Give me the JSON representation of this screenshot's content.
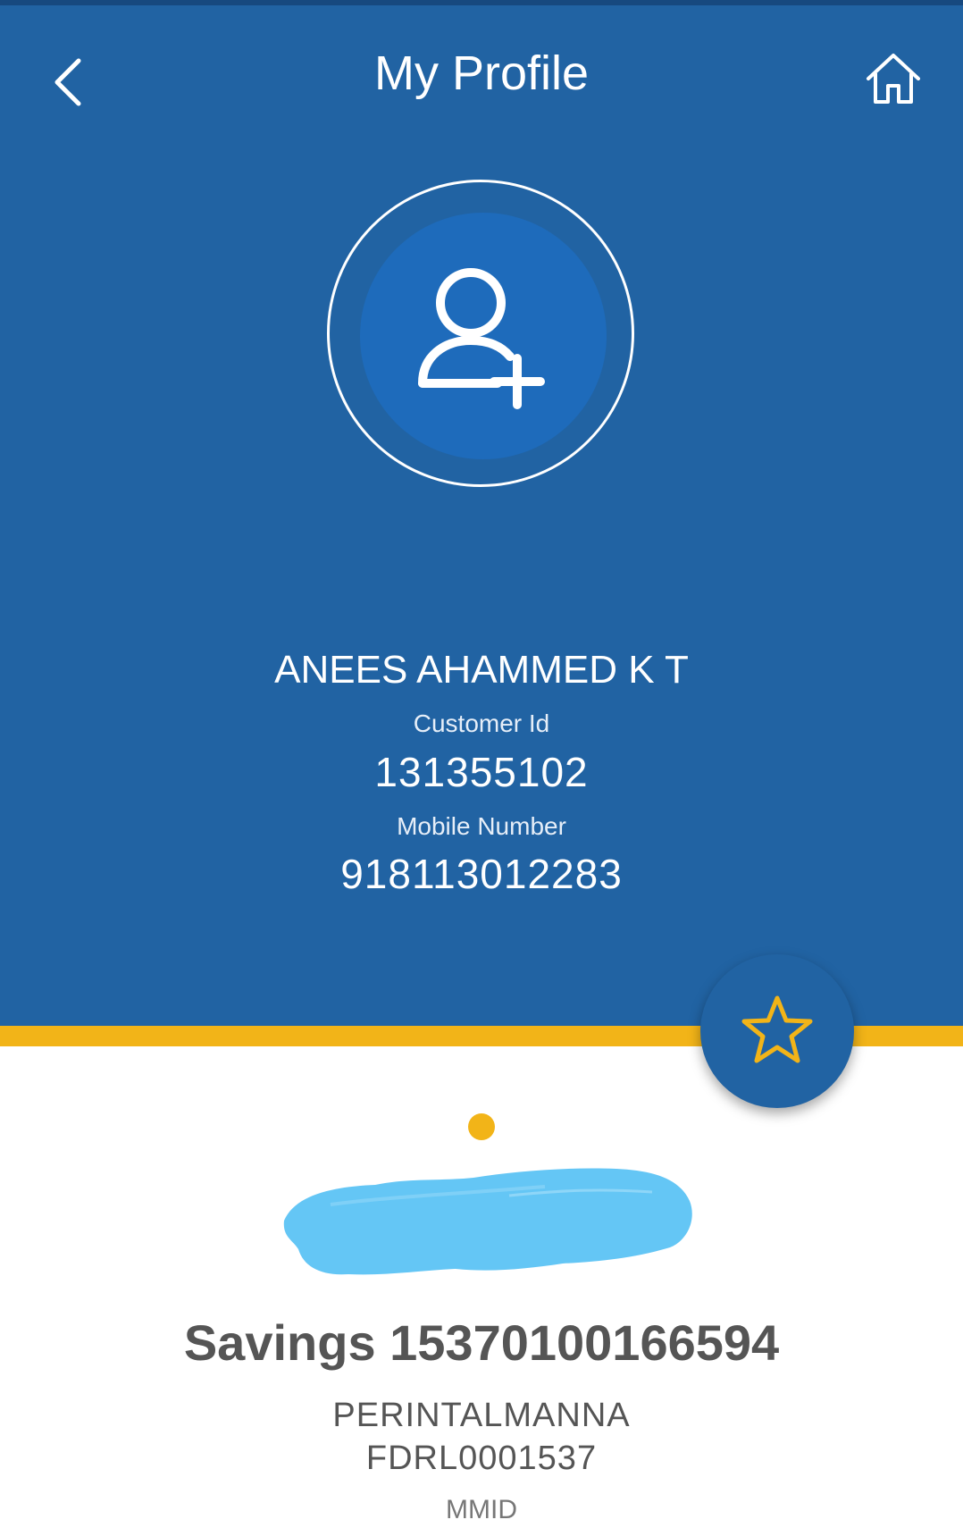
{
  "header": {
    "title": "My Profile",
    "back_icon": "chevron-left-icon",
    "home_icon": "home-icon"
  },
  "profile": {
    "avatar_icon": "add-user-icon",
    "name": "ANEES AHAMMED K T",
    "customer_id_label": "Customer Id",
    "customer_id": "131355102",
    "mobile_label": "Mobile Number",
    "mobile": "918113012283"
  },
  "favorite": {
    "icon": "star-icon"
  },
  "account": {
    "type_and_number": "Savings 15370100166594",
    "branch": "PERINTALMANNA",
    "ifsc": "FDRL0001537",
    "mmid_label": "MMID"
  },
  "colors": {
    "header_bg": "#2163a3",
    "accent": "#f2b418",
    "avatar_inner": "#1e6bbb",
    "redaction": "#64c6f5",
    "text_muted": "#555555"
  }
}
